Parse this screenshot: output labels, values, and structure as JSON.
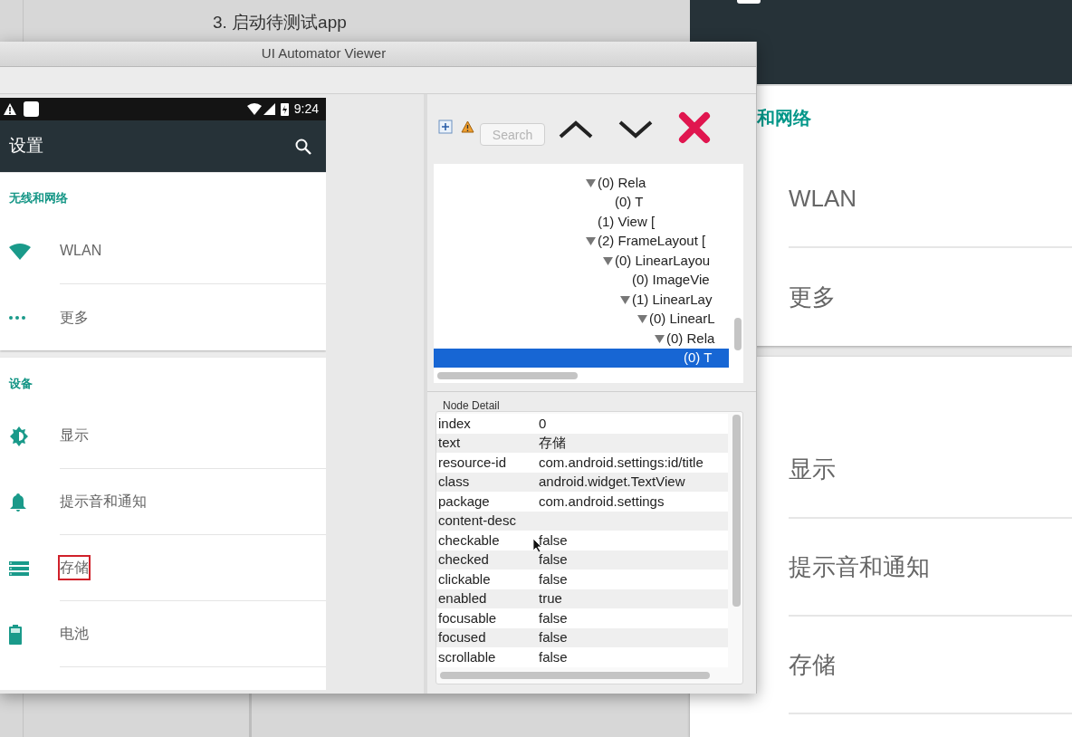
{
  "slide": {
    "heading": "3. 启动待测试app"
  },
  "emulator": {
    "sections": [
      {
        "header": "和网络",
        "items": [
          {
            "label": "WLAN"
          },
          {
            "label": "更多"
          }
        ]
      },
      {
        "items": [
          {
            "label": "显示"
          },
          {
            "label": "提示音和通知"
          },
          {
            "label": "存储"
          }
        ]
      }
    ]
  },
  "viewer": {
    "title": "UI Automator Viewer",
    "phone": {
      "time": "9:24",
      "title": "设置",
      "sections": [
        {
          "header": "无线和网络",
          "items": [
            {
              "kind": "wifi",
              "label": "WLAN",
              "highlighted": false
            },
            {
              "kind": "more",
              "label": "更多",
              "highlighted": false
            }
          ]
        },
        {
          "header": "设备",
          "items": [
            {
              "kind": "display",
              "label": "显示",
              "highlighted": false
            },
            {
              "kind": "bell",
              "label": "提示音和通知",
              "highlighted": false
            },
            {
              "kind": "storage",
              "label": "存储",
              "highlighted": true
            },
            {
              "kind": "battery",
              "label": "电池",
              "highlighted": false
            }
          ]
        }
      ]
    },
    "search": {
      "placeholder": "Search"
    },
    "tree": [
      {
        "label": "(0) Rela",
        "selected": false,
        "expanded": true,
        "children": [
          {
            "label": "(0) T",
            "selected": false
          }
        ]
      },
      {
        "label": "(1) View [",
        "selected": false
      },
      {
        "label": "(2) FrameLayout [",
        "selected": false,
        "expanded": true,
        "children": [
          {
            "label": "(0) LinearLayou",
            "selected": false,
            "expanded": true,
            "children": [
              {
                "label": "(0) ImageVie",
                "selected": false
              },
              {
                "label": "(1) LinearLay",
                "selected": false,
                "expanded": true,
                "children": [
                  {
                    "label": "(0) LinearL",
                    "selected": false,
                    "expanded": true,
                    "children": [
                      {
                        "label": "(0) Rela",
                        "selected": false,
                        "expanded": true,
                        "children": [
                          {
                            "label": "(0) T",
                            "selected": true
                          }
                        ]
                      }
                    ]
                  }
                ]
              }
            ]
          }
        ]
      }
    ],
    "node_detail": {
      "title": "Node Detail",
      "rows": [
        {
          "key": "index",
          "value": "0"
        },
        {
          "key": "text",
          "value": "存储"
        },
        {
          "key": "resource-id",
          "value": "com.android.settings:id/title"
        },
        {
          "key": "class",
          "value": "android.widget.TextView"
        },
        {
          "key": "package",
          "value": "com.android.settings"
        },
        {
          "key": "content-desc"
        },
        {
          "key": "checkable",
          "value": "false"
        },
        {
          "key": "checked",
          "value": "false"
        },
        {
          "key": "clickable",
          "value": "false"
        },
        {
          "key": "enabled",
          "value": "true"
        },
        {
          "key": "focusable",
          "value": "false"
        },
        {
          "key": "focused",
          "value": "false"
        },
        {
          "key": "scrollable",
          "value": "false"
        }
      ]
    }
  }
}
